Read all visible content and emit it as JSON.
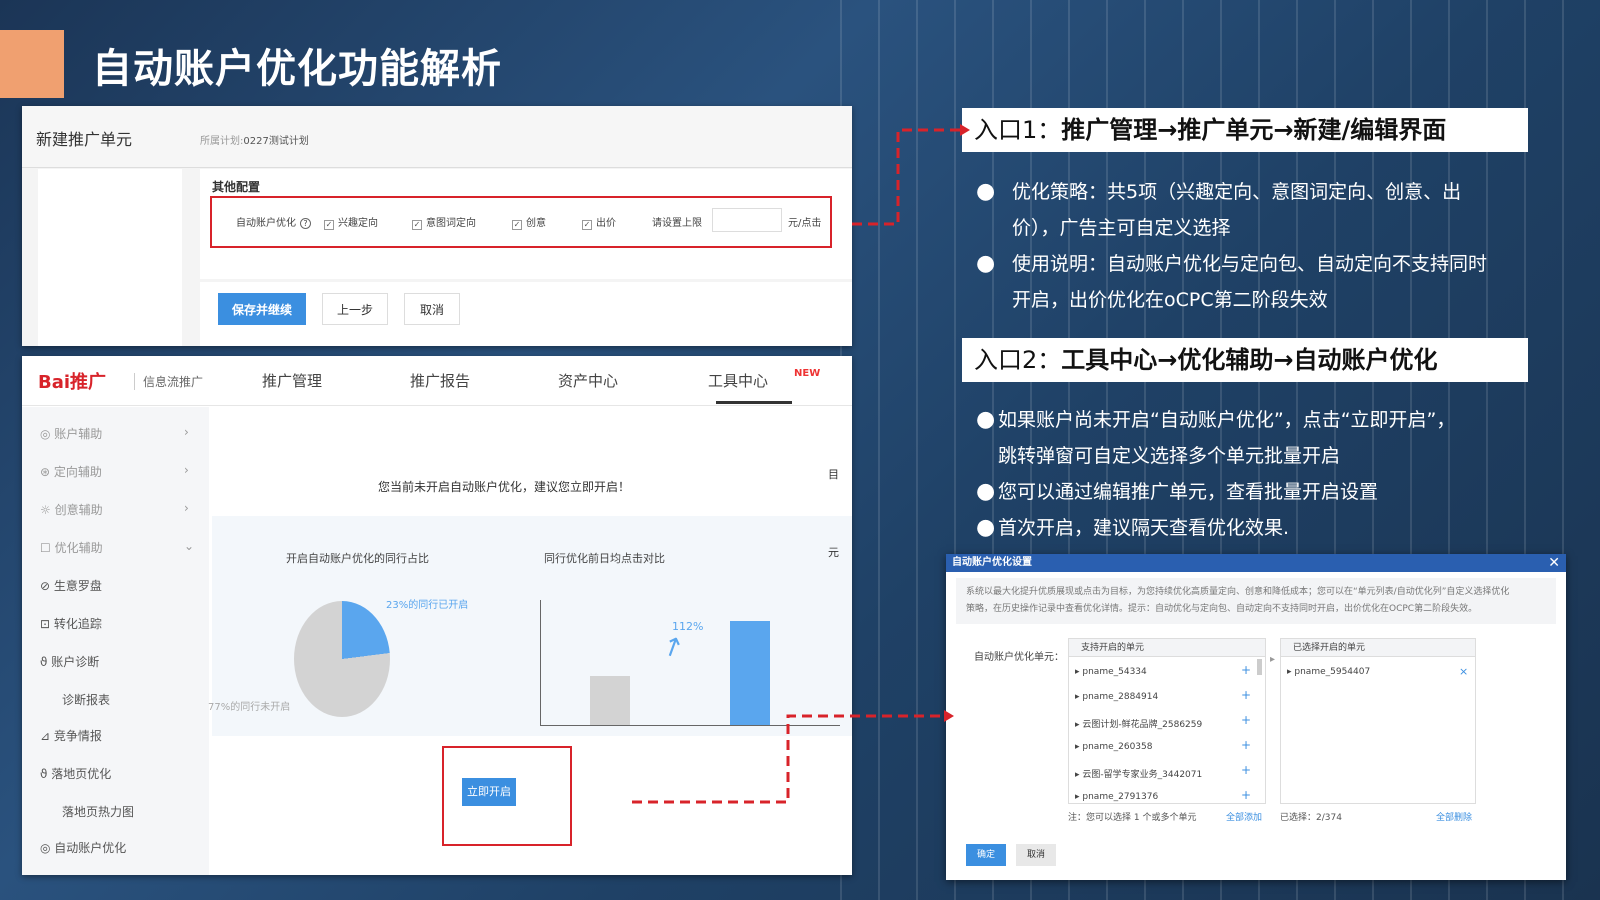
{
  "slide": {
    "title": "自动账户优化功能解析"
  },
  "new_unit_panel": {
    "title": "新建推广单元",
    "plan_label": "所属计划:",
    "plan_value": "0227测试计划",
    "section_title": "其他配置",
    "option_label": "自动账户优化",
    "help_icon": "?",
    "options": [
      "兴趣定向",
      "意图词定向",
      "创意",
      "出价"
    ],
    "cap_label": "请设置上限",
    "cap_unit": "元/点击",
    "buttons": {
      "save": "保存并继续",
      "prev": "上一步",
      "cancel": "取消"
    }
  },
  "tool_center_panel": {
    "logo_text": "Bai推广",
    "logo_sub": "信息流推广",
    "nav": [
      "推广管理",
      "推广报告",
      "资产中心",
      "工具中心"
    ],
    "nav_badge": "NEW",
    "sidebar": [
      {
        "label": "账户辅助"
      },
      {
        "label": "定向辅助"
      },
      {
        "label": "创意辅助"
      },
      {
        "label": "优化辅助"
      },
      {
        "label": "生意罗盘"
      },
      {
        "label": "转化追踪"
      },
      {
        "label": "账户诊断"
      },
      {
        "label": "诊断报表"
      },
      {
        "label": "竞争情报"
      },
      {
        "label": "落地页优化"
      },
      {
        "label": "落地页热力图"
      },
      {
        "label": "自动账户优化"
      }
    ],
    "notice": "您当前未开启自动账户优化，建议您立即开启！",
    "chart1_title": "开启自动账户优化的同行占比",
    "chart2_title": "同行优化前日均点击对比",
    "open_button": "立即开启",
    "cut_texts": [
      "目",
      "元"
    ]
  },
  "entry1": {
    "prefix": "入口1：",
    "path": "推广管理→推广单元→新建/编辑界面",
    "bullets": [
      "优化策略：共5项（兴趣定向、意图词定向、创意、出价），广告主可自定义选择",
      "使用说明：自动账户优化与定向包、自动定向不支持同时开启，出价优化在oCPC第二阶段失效"
    ],
    "bullet_lines": [
      [
        "优化策略：共5项（兴趣定向、意图词定向、创意、出",
        "价），广告主可自定义选择"
      ],
      [
        "使用说明：自动账户优化与定向包、自动定向不支持同时",
        "开启，出价优化在oCPC第二阶段失效"
      ]
    ]
  },
  "entry2": {
    "prefix": "入口2：",
    "path": "工具中心→优化辅助→自动账户优化",
    "bullet_lines": [
      [
        "如果账户尚未开启“自动账户优化”，点击“立即开启”，",
        "跳转弹窗可自定义选择多个单元批量开启"
      ],
      [
        "您可以通过编辑推广单元，查看批量开启设置"
      ],
      [
        "首次开启，建议隔天查看优化效果."
      ]
    ]
  },
  "dialog": {
    "title": "自动账户优化设置",
    "desc_lines": [
      "系统以最大化提升优质展现或点击为目标，为您持续优化高质量定向、创意和降低成本；您可以在“单元列表/自动优化列”自定义选择优化",
      "策略，在历史操作记录中查看优化详情。提示：自动优化与定向包、自动定向不支持同时开启，出价优化在OCPC第二阶段失效。"
    ],
    "field_label": "自动账户优化单元：",
    "available_header": "支持开启的单元",
    "available": [
      "pname_54334",
      "pname_2884914",
      "云图计划-鲜花品牌_2586259",
      "pname_260358",
      "云图-留学专家业务_3442071",
      "pname_2791376"
    ],
    "selected_header": "已选择开启的单元",
    "selected": [
      "pname_5954407"
    ],
    "note": "注：您可以选择 1 个或多个单元",
    "add_all": "全部添加",
    "selected_count": "已选择：2/374",
    "remove_all": "全部删除",
    "confirm": "确定",
    "cancel": "取消"
  },
  "chart_data": [
    {
      "type": "pie",
      "title": "开启自动账户优化的同行占比",
      "labels": [
        "23%的同行已开启",
        "77%的同行未开启"
      ],
      "values": [
        23,
        77
      ],
      "colors": [
        "#5aa6ee",
        "#d3d3d3"
      ]
    },
    {
      "type": "bar",
      "title": "同行优化前日均点击对比",
      "categories": [
        "",
        ""
      ],
      "values": [
        47,
        100
      ],
      "annotation": "112%",
      "colors": [
        "#d3d3d3",
        "#5aa6ee"
      ]
    }
  ],
  "colors": {
    "accent": "#3b8fe0",
    "highlight_red": "#d8232a",
    "title_block": "#f0a070",
    "background": "#1d3a5c"
  }
}
